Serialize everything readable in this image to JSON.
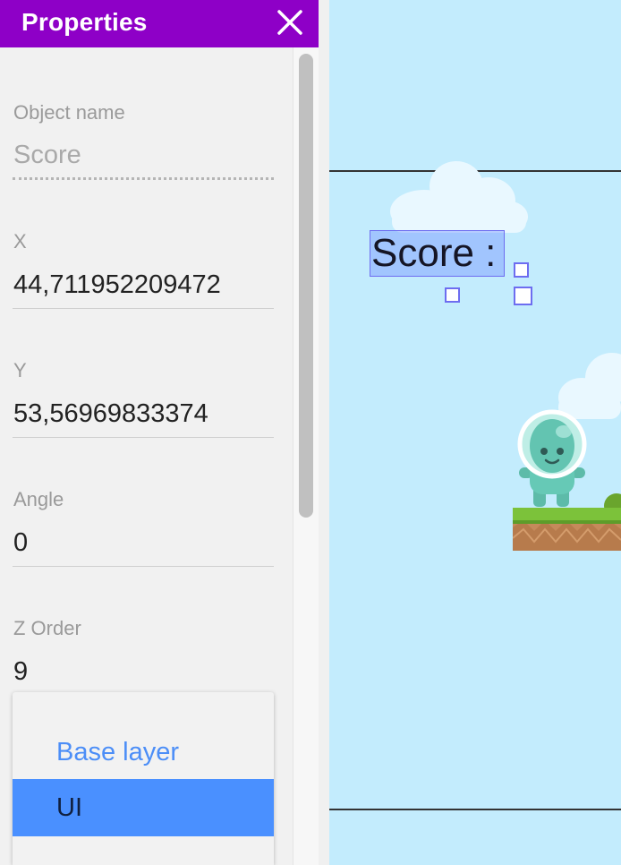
{
  "panel": {
    "title": "Properties",
    "close_icon": "close-icon"
  },
  "fields": {
    "object_name": {
      "label": "Object name",
      "value": "Score"
    },
    "x": {
      "label": "X",
      "value": "44,711952209472"
    },
    "y": {
      "label": "Y",
      "value": "53,56969833374"
    },
    "angle": {
      "label": "Angle",
      "value": "0"
    },
    "z_order": {
      "label": "Z Order",
      "value": "9"
    }
  },
  "layer_dropdown": {
    "options": [
      "Base layer",
      "UI"
    ],
    "selected": "UI"
  },
  "canvas": {
    "text_object": "Score :",
    "background_color": "#c3ecfd"
  },
  "colors": {
    "header": "#8e00c7",
    "selection": "#4a90ff",
    "link_blue": "#4c8ef7"
  }
}
